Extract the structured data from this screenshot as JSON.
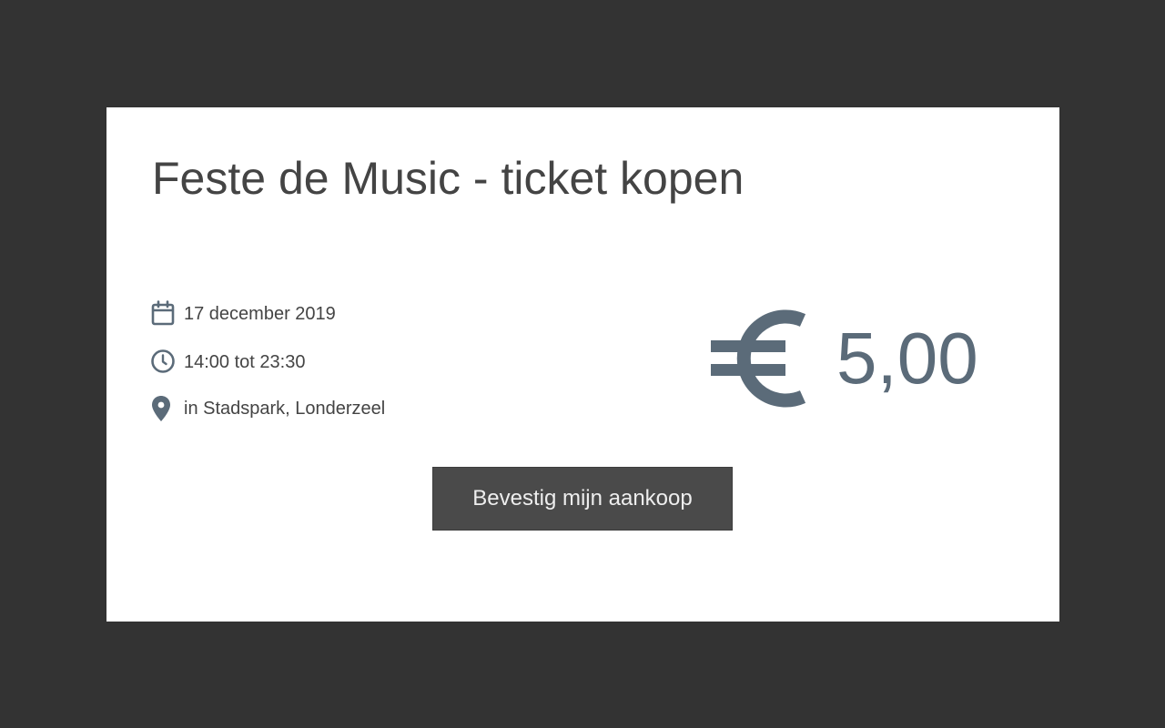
{
  "modal": {
    "title": "Feste de Music - ticket kopen"
  },
  "event": {
    "date": "17 december 2019",
    "time": "14:00 tot 23:30",
    "location": "in Stadspark, Londerzeel"
  },
  "price": {
    "currency_icon": "euro-icon",
    "amount": "5,00"
  },
  "actions": {
    "confirm_label": "Bevestig mijn aankoop"
  },
  "icons": {
    "date": "calendar-icon",
    "time": "clock-icon",
    "location": "map-pin-icon"
  },
  "colors": {
    "backdrop": "#333333",
    "card": "#ffffff",
    "text": "#444444",
    "icon": "#5b6b79",
    "button": "#4a4a4a",
    "button_text": "#eeeeee"
  }
}
